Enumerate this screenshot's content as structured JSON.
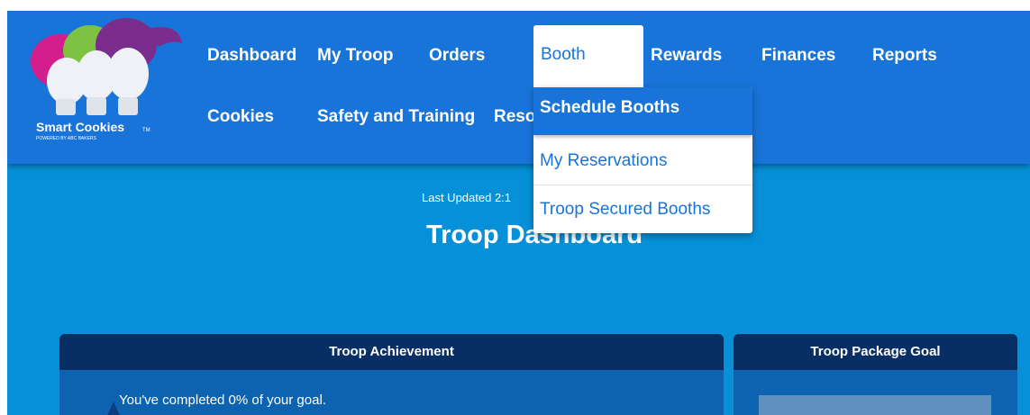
{
  "brand": {
    "name": "Smart Cookies",
    "tagline": "POWERED BY ABC BAKERS",
    "tm": "TM"
  },
  "nav": {
    "items": [
      "Dashboard",
      "My Troop",
      "Orders",
      "Booth",
      "Rewards",
      "Finances",
      "Reports",
      "Cookies",
      "Safety and Training",
      "Reso"
    ],
    "active": "Booth"
  },
  "booth_menu": {
    "items": [
      "Schedule Booths",
      "My Reservations",
      "Troop Secured Booths"
    ],
    "highlighted": "Schedule Booths"
  },
  "page": {
    "last_updated": "Last Updated 2:1",
    "title": "Troop Dashboard"
  },
  "cards": {
    "achievement": {
      "title": "Troop Achievement",
      "progress_text": "You've completed 0% of your goal.",
      "progress_percent": 0
    },
    "package_goal": {
      "title": "Troop Package Goal"
    }
  },
  "colors": {
    "header": "#1874d8",
    "background": "#0590d8",
    "card_header": "#072f66",
    "card_body": "#0d63b0"
  }
}
